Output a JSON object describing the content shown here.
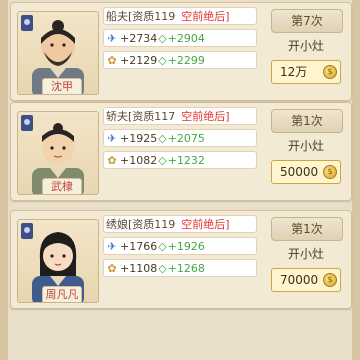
{
  "colors": {
    "accent_red": "#e0362c",
    "stat_green": "#45a746",
    "stat_blue": "#3c6fd8"
  },
  "cards": [
    {
      "name": "沈甲",
      "role": "船夫[资质119",
      "rank": "空前绝后]",
      "stat1_icon": "speed-icon",
      "stat1_from": "+2734",
      "stat1_to": "+2904",
      "stat2_icon": "yield-icon",
      "stat2_from": "+2129",
      "stat2_to": "+2299",
      "count": "第7次",
      "action": "开小灶",
      "price": "12万"
    },
    {
      "name": "武棣",
      "role": "轿夫[资质117",
      "rank": "空前绝后]",
      "stat1_icon": "speed-icon",
      "stat1_from": "+1925",
      "stat1_to": "+2075",
      "stat2_icon": "yield-icon",
      "stat2_from": "+1082",
      "stat2_to": "+1232",
      "count": "第1次",
      "action": "开小灶",
      "price": "50000"
    },
    {
      "name": "周凡凡",
      "role": "绣娘[资质119",
      "rank": "空前绝后]",
      "stat1_icon": "speed-icon",
      "stat1_from": "+1766",
      "stat1_to": "+1926",
      "stat2_icon": "yield-icon",
      "stat2_from": "+1108",
      "stat2_to": "+1268",
      "count": "第1次",
      "action": "开小灶",
      "price": "70000"
    }
  ]
}
